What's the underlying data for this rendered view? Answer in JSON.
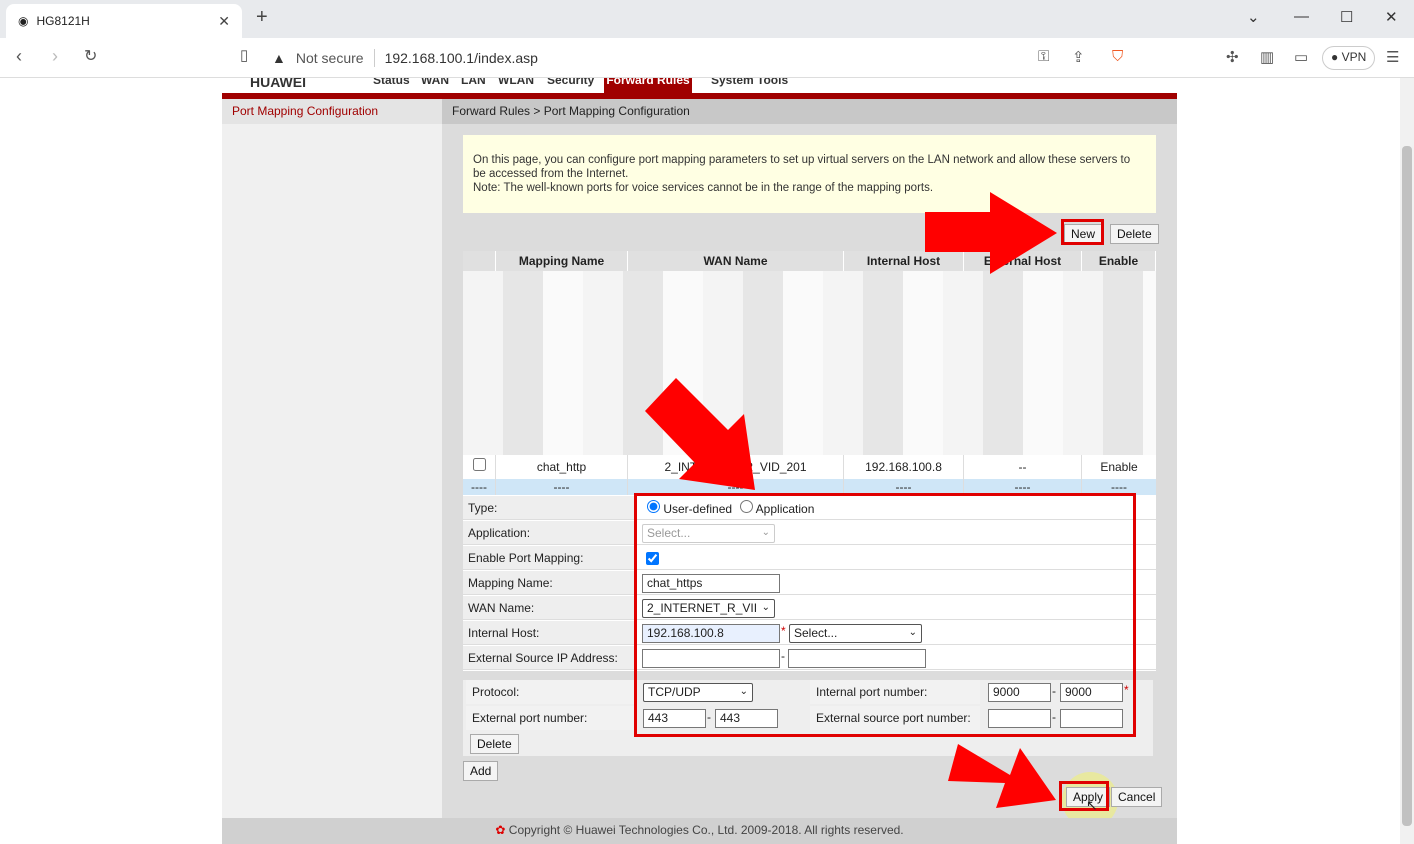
{
  "browser": {
    "tab_title": "HG8121H",
    "security": "Not secure",
    "url": "192.168.100.1/index.asp",
    "vpn": "VPN"
  },
  "router": {
    "brand": "HUAWEI",
    "menu": [
      "Status",
      "WAN",
      "LAN",
      "WLAN",
      "Security",
      "Forward Rules",
      "System Tools"
    ],
    "active_menu": "Forward Rules",
    "side_title": "Port Mapping Configuration",
    "breadcrumb": "Forward Rules > Port Mapping Configuration"
  },
  "note": {
    "line1": "On this page, you can configure port mapping parameters to set up virtual servers on the LAN network and allow these servers to be accessed from the Internet.",
    "line2": "Note: The well-known ports for voice services cannot be in the range of the mapping ports."
  },
  "buttons": {
    "new": "New",
    "delete": "Delete",
    "row_delete": "Delete",
    "add": "Add",
    "apply": "Apply",
    "cancel": "Cancel"
  },
  "table": {
    "headers": [
      "",
      "Mapping Name",
      "WAN Name",
      "Internal Host",
      "External Host",
      "Enable"
    ],
    "rows": [
      {
        "name": "chat_http",
        "wan": "2_INTERNET_R_VID_201",
        "host": "192.168.100.8",
        "ext": "--",
        "enable": "Enable"
      }
    ],
    "placeholder_row": [
      "----",
      "----",
      "----",
      "----",
      "----",
      "----"
    ]
  },
  "form": {
    "type_label": "Type:",
    "type_options": [
      "User-defined",
      "Application"
    ],
    "type_selected": "User-defined",
    "application_label": "Application:",
    "application_value": "Select...",
    "enable_label": "Enable Port Mapping:",
    "enable_checked": true,
    "name_label": "Mapping Name:",
    "name_value": "chat_https",
    "wan_label": "WAN Name:",
    "wan_value": "2_INTERNET_R_VII",
    "host_label": "Internal Host:",
    "host_value": "192.168.100.8",
    "host_select": "Select...",
    "ext_ip_label": "External Source IP Address:",
    "protocol_label": "Protocol:",
    "protocol_value": "TCP/UDP",
    "int_port_label": "Internal port number:",
    "int_port_start": "9000",
    "int_port_end": "9000",
    "ext_port_label": "External port number:",
    "ext_port_start": "443",
    "ext_port_end": "443",
    "ext_src_port_label": "External source port number:"
  },
  "footer": "Copyright © Huawei Technologies Co., Ltd. 2009-2018. All rights reserved.",
  "colors": {
    "accent": "#a00000",
    "annotation": "#e00000"
  }
}
